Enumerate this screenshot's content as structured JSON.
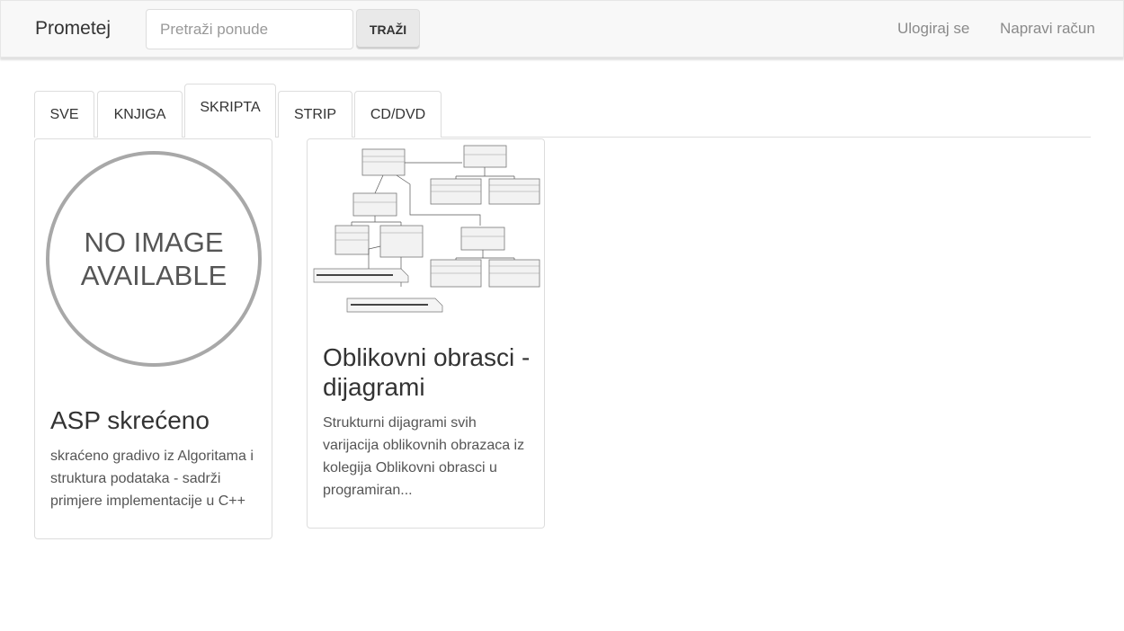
{
  "navbar": {
    "brand": "Prometej",
    "search_placeholder": "Pretraži ponude",
    "search_button": "TRAŽI",
    "login": "Ulogiraj se",
    "register": "Napravi račun"
  },
  "tabs": [
    {
      "label": "SVE",
      "active": false
    },
    {
      "label": "KNJIGA",
      "active": false
    },
    {
      "label": "SKRIPTA",
      "active": true
    },
    {
      "label": "STRIP",
      "active": false
    },
    {
      "label": "CD/DVD",
      "active": false
    }
  ],
  "cards": [
    {
      "image_line1": "NO IMAGE",
      "image_line2": "AVAILABLE",
      "title": "ASP skrećeno",
      "description": "skraćeno gradivo iz Algoritama i struktura podataka - sadrži primjere implementacije u C++"
    },
    {
      "image": "uml-class-diagram",
      "title": "Oblikovni obrasci - dijagrami",
      "description": "Strukturni dijagrami svih varijacija oblikovnih obrazaca iz kolegija Oblikovni obrasci u programiran..."
    }
  ]
}
